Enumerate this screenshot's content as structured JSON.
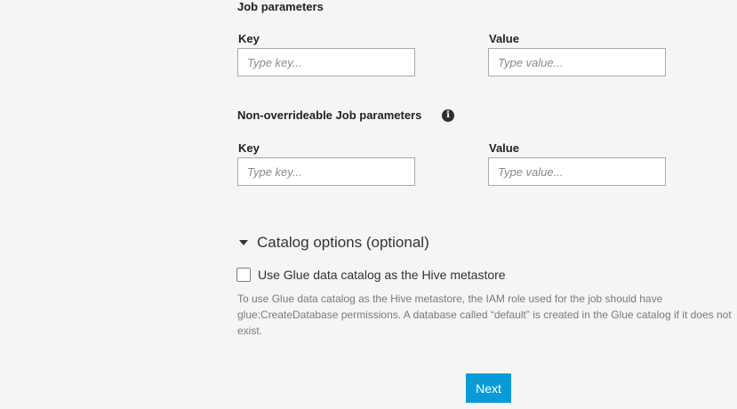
{
  "job_parameters": {
    "title": "Job parameters",
    "key_label": "Key",
    "value_label": "Value",
    "key_placeholder": "Type key...",
    "value_placeholder": "Type value..."
  },
  "non_overrideable": {
    "title": "Non-overrideable Job parameters",
    "key_label": "Key",
    "value_label": "Value",
    "key_placeholder": "Type key...",
    "value_placeholder": "Type value..."
  },
  "catalog_options": {
    "title": "Catalog options (optional)",
    "expanded": true,
    "checkbox_label": "Use Glue data catalog as the Hive metastore",
    "checkbox_checked": false,
    "help_text": "To use Glue data catalog as the Hive metastore, the IAM role used for the job should have glue:CreateDatabase permissions. A database called “default” is created in the Glue catalog if it does not exist."
  },
  "actions": {
    "next_label": "Next"
  },
  "icons": {
    "info_icon": "info-circle",
    "caret_icon": "caret-down"
  },
  "colors": {
    "background": "#f4f5f4",
    "primary_button": "#0a9bd7"
  }
}
